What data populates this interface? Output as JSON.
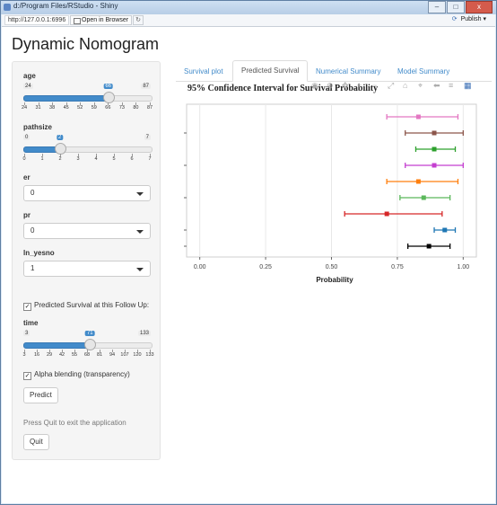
{
  "window": {
    "title": "d:/Program Files/RStudio - Shiny",
    "min": "–",
    "max": "□",
    "close": "x"
  },
  "toolbar": {
    "url": "http://127.0.0.1:6996",
    "open_browser": "Open in Browser",
    "refresh": "↻",
    "publish": "Publish",
    "publish_dropdown": "▾"
  },
  "app": {
    "title": "Dynamic Nomogram"
  },
  "sidebar": {
    "age": {
      "label": "age",
      "min": "24",
      "max": "87",
      "value": "66",
      "value_num": 66,
      "min_num": 24,
      "max_num": 87,
      "ticks": [
        "24",
        "31",
        "38",
        "45",
        "52",
        "59",
        "66",
        "73",
        "80",
        "87"
      ]
    },
    "pathsize": {
      "label": "pathsize",
      "min": "0",
      "max": "7",
      "value": "2",
      "value_num": 2,
      "min_num": 0,
      "max_num": 7,
      "ticks": [
        "0",
        "1",
        "2",
        "3",
        "4",
        "5",
        "6",
        "7"
      ]
    },
    "er": {
      "label": "er",
      "value": "0"
    },
    "pr": {
      "label": "pr",
      "value": "0"
    },
    "ln_yesno": {
      "label": "ln_yesno",
      "value": "1"
    },
    "followup_check": {
      "label": "Predicted Survival at this Follow Up:",
      "mark": "✓"
    },
    "time": {
      "label": "time",
      "min": "3",
      "max": "133",
      "value": "71",
      "value_num": 71,
      "min_num": 3,
      "max_num": 133,
      "ticks": [
        "3",
        "16",
        "29",
        "42",
        "55",
        "68",
        "81",
        "94",
        "107",
        "120",
        "133"
      ]
    },
    "alpha_check": {
      "label": "Alpha blending (transparency)",
      "mark": "✓"
    },
    "predict": "Predict",
    "quit_hint": "Press Quit to exit the application",
    "quit": "Quit"
  },
  "tabs": [
    "Survival plot",
    "Predicted Survival",
    "Numerical Summary",
    "Model Summary"
  ],
  "modebar_icons": [
    "camera-icon",
    "zoom-icon",
    "pan-icon",
    "zoom-in-icon",
    "zoom-out-icon",
    "autoscale-icon",
    "reset-axes-icon",
    "spike-lines-icon",
    "hover-closest-icon",
    "compare-icon",
    "plotly-logo-icon"
  ],
  "modebar_glyphs": [
    "◉",
    "⊕",
    "✥",
    "+",
    "−",
    "⤢",
    "⌂",
    "⌖",
    "⬅",
    "≡",
    "▦"
  ],
  "colors": {
    "accent": "#428bca"
  },
  "chart_data": {
    "type": "scatter",
    "title": "95% Confidence Interval for Survival Probability",
    "xlabel": "Probability",
    "xlim": [
      -0.05,
      1.05
    ],
    "xticks": [
      "0.00",
      "0.25",
      "0.50",
      "0.75",
      "1.00"
    ],
    "xtick_values": [
      0,
      0.25,
      0.5,
      0.75,
      1.0
    ],
    "grid": true,
    "series": [
      {
        "color": "#e377c2",
        "est": 0.83,
        "lo": 0.71,
        "hi": 0.98
      },
      {
        "color": "#8c564b",
        "est": 0.89,
        "lo": 0.78,
        "hi": 1.0
      },
      {
        "color": "#2ca02c",
        "est": 0.89,
        "lo": 0.82,
        "hi": 0.97
      },
      {
        "color": "#c43fd0",
        "est": 0.89,
        "lo": 0.78,
        "hi": 1.0
      },
      {
        "color": "#ff7f0e",
        "est": 0.83,
        "lo": 0.71,
        "hi": 0.98
      },
      {
        "color": "#5bb85b",
        "est": 0.85,
        "lo": 0.76,
        "hi": 0.95
      },
      {
        "color": "#d62728",
        "est": 0.71,
        "lo": 0.55,
        "hi": 0.92
      },
      {
        "color": "#1f77b4",
        "est": 0.93,
        "lo": 0.89,
        "hi": 0.97
      },
      {
        "color": "#000000",
        "est": 0.87,
        "lo": 0.79,
        "hi": 0.95
      }
    ]
  }
}
